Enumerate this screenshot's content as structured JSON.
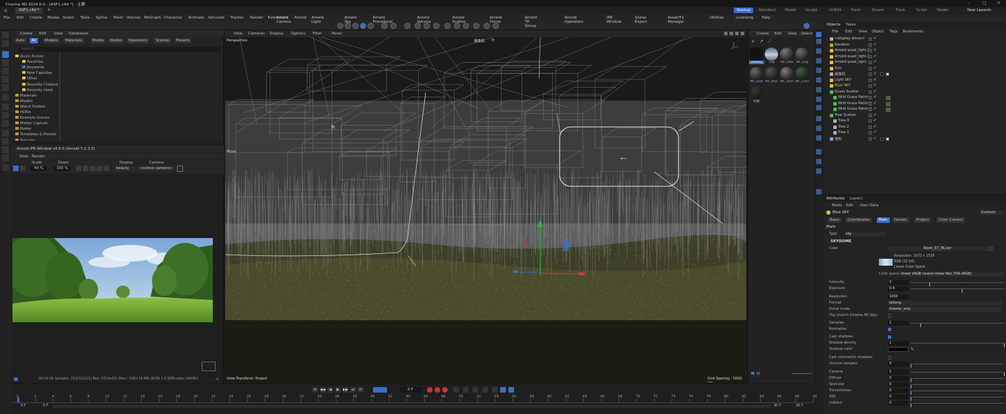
{
  "window": {
    "title": "Cinema 4D 2024.0.0 - [ASF1.c4d *] - 主要",
    "document_tab": "ASF1.c4d *",
    "controls": [
      "–",
      "□",
      "✕"
    ]
  },
  "layouts": {
    "items": [
      "Startup",
      "Standard",
      "Model",
      "Sculpt",
      "UVEdit",
      "Paint",
      "Groom",
      "Track",
      "Script",
      "Nodes"
    ],
    "active": "Startup",
    "new_layouts": "New Layouts"
  },
  "menubar": [
    "File",
    "Edit",
    "Create",
    "Modes",
    "Select",
    "Tools",
    "Spline",
    "Mesh",
    "Volume",
    "MoGraph",
    "Character",
    "Animate",
    "Simulate",
    "Tracker",
    "Render",
    "Extensions",
    "Arnold"
  ],
  "arnold_toolbar": [
    "Arnold Camera",
    "Arnold Light",
    "Arnold Sky",
    "Arnold Procedural",
    "Arnold Volume",
    "Arnold Scatter",
    "Arnold Driver",
    "Arnold TP Group",
    "Arnold Operators",
    "IPR Window",
    "Scene Export",
    "Asset/Tx Manager",
    "Utilities",
    "Licensing",
    "Help"
  ],
  "asset_browser": {
    "menu": [
      "Create",
      "Edit",
      "View",
      "Databases"
    ],
    "filters": [
      "Auto",
      "All",
      "Models",
      "Materials",
      "Media",
      "Nodes",
      "Operators",
      "Scenes",
      "Presets"
    ],
    "active_filter": "All",
    "search_placeholder": "Search",
    "tree": [
      {
        "label": "Quick Access",
        "depth": 0
      },
      {
        "label": "Favorites",
        "depth": 1
      },
      {
        "label": "Keywords",
        "depth": 1
      },
      {
        "label": "New Capsules",
        "depth": 1
      },
      {
        "label": "Other",
        "depth": 1
      },
      {
        "label": "Recently Created",
        "depth": 1
      },
      {
        "label": "Recently Used",
        "depth": 1
      },
      {
        "label": "Materials",
        "depth": 0
      },
      {
        "label": "Models",
        "depth": 0
      },
      {
        "label": "Watch Folders",
        "depth": 0
      },
      {
        "label": "HDRIs",
        "depth": 0
      },
      {
        "label": "Example Scenes",
        "depth": 0
      },
      {
        "label": "Motion Capture",
        "depth": 0
      },
      {
        "label": "Nodes",
        "depth": 0
      },
      {
        "label": "Templates & Presets",
        "depth": 0
      },
      {
        "label": "Textures",
        "depth": 0
      }
    ]
  },
  "ipr": {
    "title": "Arnold IPR Window v4.6.5 (Arnold 7.2.3.3)",
    "menu": [
      "View",
      "Render"
    ],
    "scale_label": "Scale",
    "scale_value": "40 %",
    "zoom_label": "Zoom",
    "zoom_value": "100 %",
    "display_label": "Display",
    "display_value": "beauty",
    "camera_label": "Camera",
    "camera_value": "<active camera>",
    "status": "00:01:06 Samples: [5/2/2/2/2/2] Res: 1024x432 Mem: 9382.18 MB (ACES 1.0 SDR-video (sRGB))"
  },
  "viewport": {
    "menu": [
      "View",
      "Cameras",
      "Display",
      "Options",
      "Filter",
      "Panel"
    ],
    "label": "Perspective",
    "camera_name": "摄像机",
    "move_label": "Move",
    "transform_label": "View Transform: Project",
    "grid_spacing": "Grid Spacing : 5000 cm"
  },
  "material_manager": {
    "menu": [
      "Create",
      "Edit",
      "View",
      "Select"
    ],
    "materials": [
      {
        "name": "atmosp",
        "color": "#111111",
        "selected": true
      },
      {
        "name": "fog",
        "color": "#8fa4b5",
        "selected": false
      },
      {
        "name": "MF_Pebi",
        "color": "#7a7a7a",
        "selected": false
      },
      {
        "name": "MF_Slig",
        "color": "#6f6f6f",
        "selected": false
      },
      {
        "name": "MF_Leaf",
        "color": "#6a6a6a",
        "selected": false
      },
      {
        "name": "MF_Blac",
        "color": "#555555",
        "selected": false
      },
      {
        "name": "MF_Ston",
        "color": "#7c7c7c",
        "selected": false
      },
      {
        "name": "MF_Gras",
        "color": "#3f5e3c",
        "selected": false
      },
      {
        "name": "材质",
        "color": "#2f3b2a",
        "selected": false
      }
    ]
  },
  "objects": {
    "tabs": [
      "Objects",
      "Takes"
    ],
    "menu": [
      "File",
      "Edit",
      "View",
      "Object",
      "Tags",
      "Bookmarks"
    ],
    "rows": [
      {
        "name": "<display driver>",
        "depth": 0,
        "icon": "#b0b0b0"
      },
      {
        "name": "Random",
        "depth": 0,
        "icon": "#c7a23a"
      },
      {
        "name": "Arnold quad_light.2",
        "depth": 0,
        "icon": "#e0c548"
      },
      {
        "name": "Arnold quad_light.1",
        "depth": 0,
        "icon": "#e0c548"
      },
      {
        "name": "Arnold quad_light",
        "depth": 0,
        "icon": "#e0c548"
      },
      {
        "name": "Sun",
        "depth": 0,
        "icon": "#e0c548"
      },
      {
        "name": "摄像机",
        "depth": 0,
        "icon": "#b0b0b0"
      },
      {
        "name": "Light SKY",
        "depth": 0,
        "icon": "#e0c548"
      },
      {
        "name": "Blue SKY",
        "depth": 0,
        "icon": "#e0c548",
        "highlight": true
      },
      {
        "name": "Grass Scatter",
        "depth": 0,
        "icon": "#4ec04e"
      },
      {
        "name": "Wild Grass Patch",
        "depth": 1,
        "icon": "#4ec04e"
      },
      {
        "name": "Wild Grass Patch.1",
        "depth": 1,
        "icon": "#4ec04e"
      },
      {
        "name": "Wild Grass Patch.2",
        "depth": 1,
        "icon": "#4ec04e"
      },
      {
        "name": "Tree Scatter",
        "depth": 0,
        "icon": "#4ec04e"
      },
      {
        "name": "Tree-3",
        "depth": 1,
        "icon": "#b0b0b0"
      },
      {
        "name": "Tree-2",
        "depth": 1,
        "icon": "#b0b0b0"
      },
      {
        "name": "Tree-1",
        "depth": 1,
        "icon": "#b0b0b0"
      },
      {
        "name": "地形",
        "depth": 0,
        "icon": "#7fa4d6"
      }
    ]
  },
  "attributes": {
    "tabs": [
      "Attributes",
      "Layers"
    ],
    "menu": [
      "Mode",
      "Edit",
      "User Data"
    ],
    "object_name": "Blue SKY",
    "preset": "Custom",
    "subtabs": [
      "Basic",
      "Coordinates",
      "Main",
      "Details",
      "Project",
      "Color Correct"
    ],
    "active_subtab": "Main",
    "section": "Main",
    "type_label": "Type",
    "type_value": "sky",
    "group": "SKYDOME",
    "color_label": "Color",
    "texture_file": "Noon_07_3K.exr",
    "resolution_info": "Resolution: 3072 x 1536",
    "rgb_info": "RGB (32 bit)",
    "linear_info": "Linear Color Space",
    "colorspace_label": "Color space",
    "colorspace_value": "linear sRGB (scene-linear Rec.709-sRGB)",
    "params": [
      {
        "label": "Intensity",
        "value": "2",
        "slider": 0.2
      },
      {
        "label": "Exposure",
        "value": "0.4",
        "slider": 0.55
      },
      {
        "label": "Resolution",
        "value": "1000",
        "slider": null
      },
      {
        "label": "Format",
        "value": "latlong",
        "dropdown": true
      },
      {
        "label": "Portal mode",
        "value": "interior_only",
        "dropdown": true
      },
      {
        "label": "Flip (match Cinema 4D Sky)",
        "checkbox": false
      },
      {
        "label": "Samples",
        "value": "1",
        "slider": 0.1
      },
      {
        "label": "Normalize",
        "checkbox": true
      },
      {
        "label": "Cast shadows",
        "checkbox": true
      },
      {
        "label": "Shadow density",
        "value": "1",
        "slider": 1.0
      },
      {
        "label": "Shadow color",
        "swatch": "#000000"
      },
      {
        "label": "Cast volumetric shadows",
        "checkbox": false
      },
      {
        "label": "Volume samples",
        "value": "0",
        "slider": 0.0
      },
      {
        "label": "Camera",
        "value": "1",
        "slider": 1.0
      },
      {
        "label": "Diffuse",
        "value": "0",
        "slider": 0.0
      },
      {
        "label": "Specular",
        "value": "0",
        "slider": 0.0
      },
      {
        "label": "Transmission",
        "value": "0",
        "slider": 0.0
      },
      {
        "label": "SSS",
        "value": "0",
        "slider": 0.0
      },
      {
        "label": "Indirect",
        "value": "0",
        "slider": 0.0
      }
    ]
  },
  "timeline": {
    "ticks": [
      "0",
      "2",
      "4",
      "6",
      "8",
      "10",
      "12",
      "14",
      "16",
      "18",
      "20",
      "22",
      "24",
      "26",
      "28",
      "30",
      "32",
      "34",
      "36",
      "38",
      "40",
      "42",
      "44",
      "46",
      "48",
      "50",
      "52",
      "54",
      "56",
      "58",
      "60",
      "62",
      "64",
      "66",
      "68",
      "70",
      "72",
      "74",
      "76",
      "78",
      "80",
      "82",
      "84",
      "86",
      "88",
      "90"
    ],
    "current_frame": "0 F",
    "start_left": "0 F",
    "start_right": "0 F",
    "end_left": "90 F",
    "end_right": "90 F"
  },
  "colors": {
    "accent": "#3b6fc7",
    "panel": "#232323",
    "selection": "#e0c548",
    "check": "#4ec04e"
  }
}
